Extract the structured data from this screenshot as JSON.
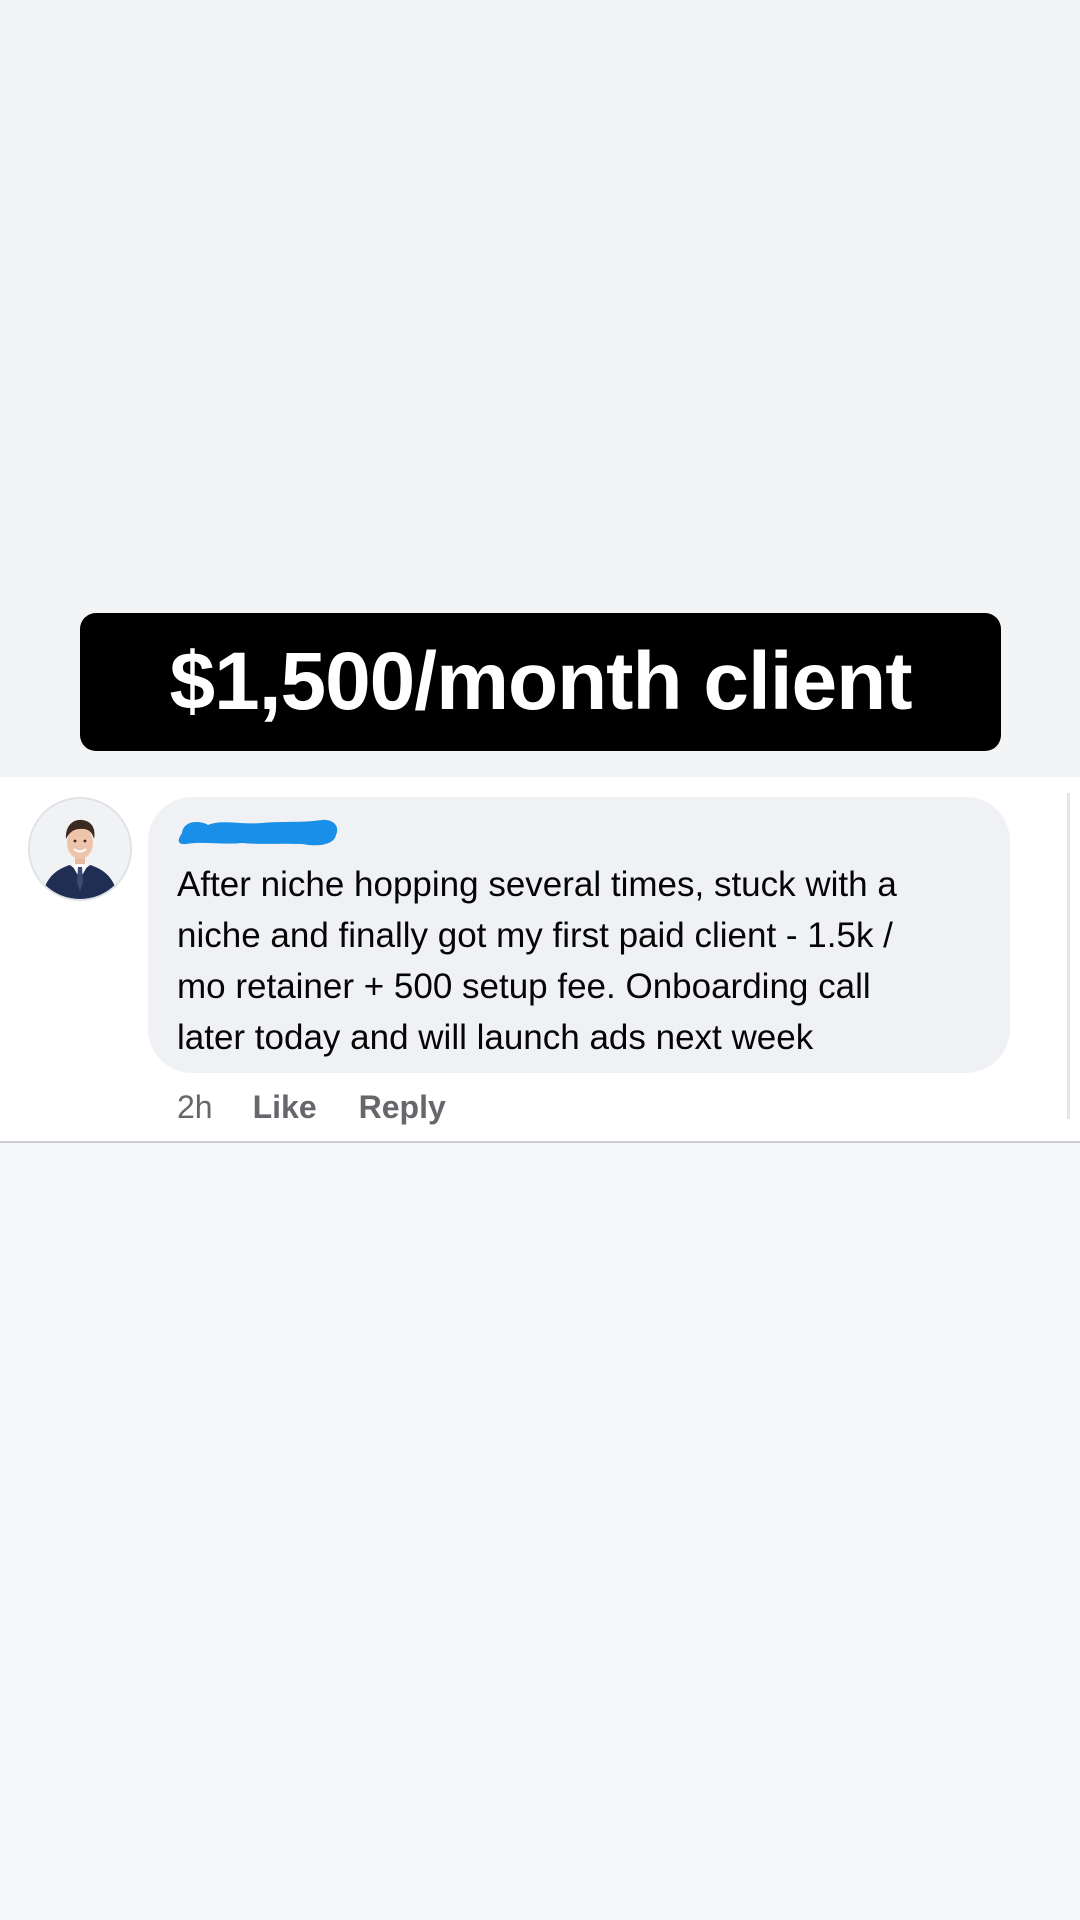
{
  "headline": {
    "text": "$1,500/month client",
    "background": "#000000",
    "color": "#ffffff"
  },
  "comment": {
    "author_redaction_color": "#1a8fe8",
    "avatar": "profile-photo-man-in-suit",
    "text": "After niche hopping several times, stuck with a\nniche and finally got my first paid client - 1.5k /\nmo retainer + 500 setup fee. Onboarding call\nlater today and will launch ads next week",
    "timestamp": "2h",
    "like_label": "Like",
    "reply_label": "Reply",
    "bubble_color": "#eff1f4",
    "action_color": "#65676b"
  }
}
